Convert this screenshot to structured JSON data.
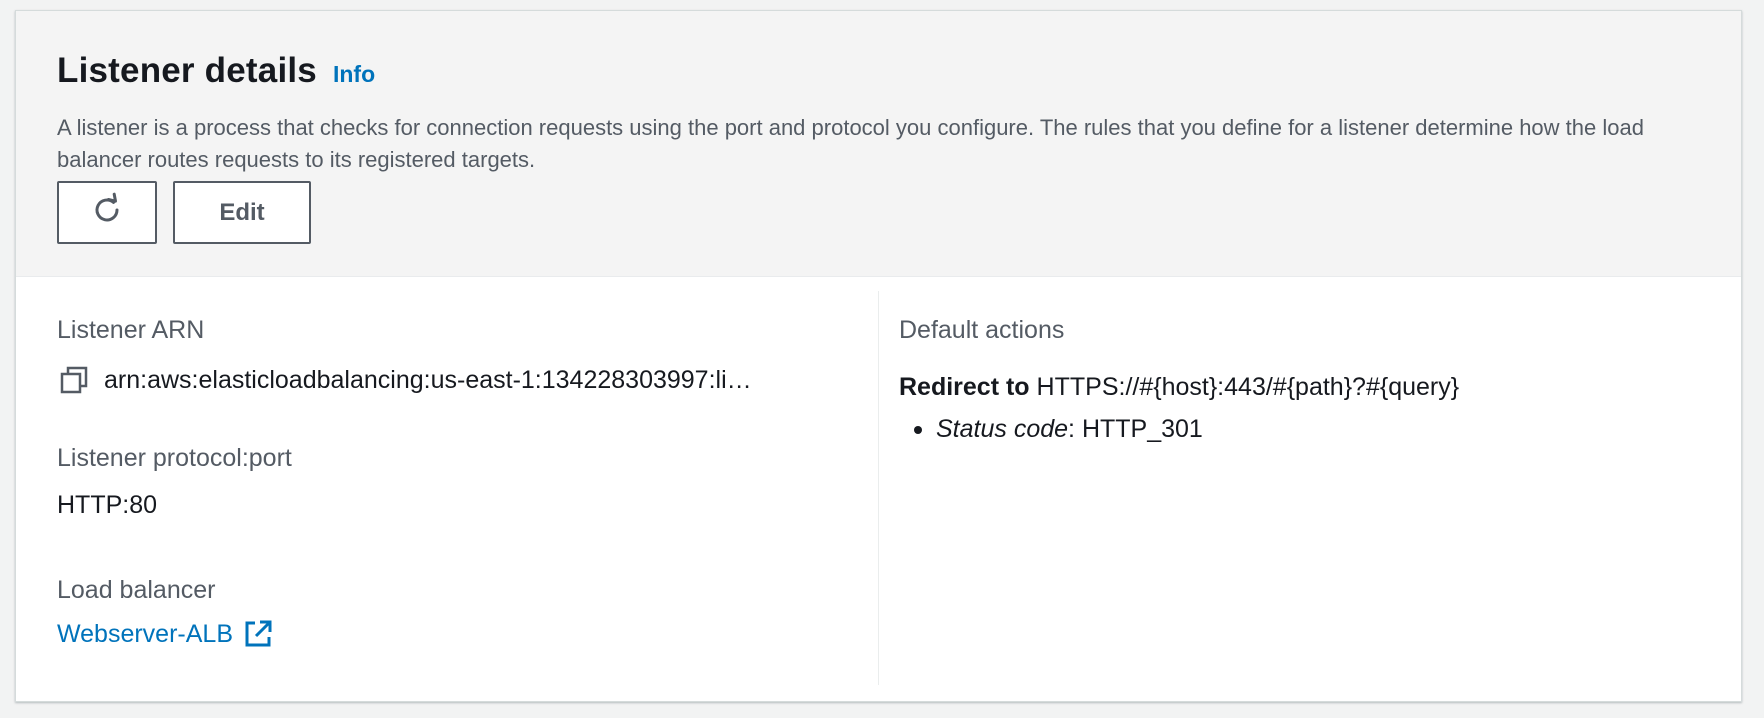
{
  "header": {
    "title": "Listener details",
    "info_label": "Info",
    "description": "A listener is a process that checks for connection requests using the port and protocol you configure. The rules that you define for a listener determine how the load balancer routes requests to its registered targets.",
    "edit_label": "Edit"
  },
  "details": {
    "arn_label": "Listener ARN",
    "arn_value": "arn:aws:elasticloadbalancing:us-east-1:134228303997:li…",
    "protocol_label": "Listener protocol:port",
    "protocol_value": "HTTP:80",
    "lb_label": "Load balancer",
    "lb_value": "Webserver-ALB"
  },
  "actions": {
    "label": "Default actions",
    "redirect_prefix": "Redirect to",
    "redirect_target": "HTTPS://#{host}:443/#{path}?#{query}",
    "status_key": "Status code",
    "status_value": "HTTP_301"
  },
  "icons": {
    "refresh": "refresh-icon",
    "copy": "copy-icon",
    "external": "external-link-icon"
  },
  "colors": {
    "link": "#0073bb",
    "text": "#16191f",
    "muted": "#545b64",
    "header_bg": "#f4f4f4"
  }
}
